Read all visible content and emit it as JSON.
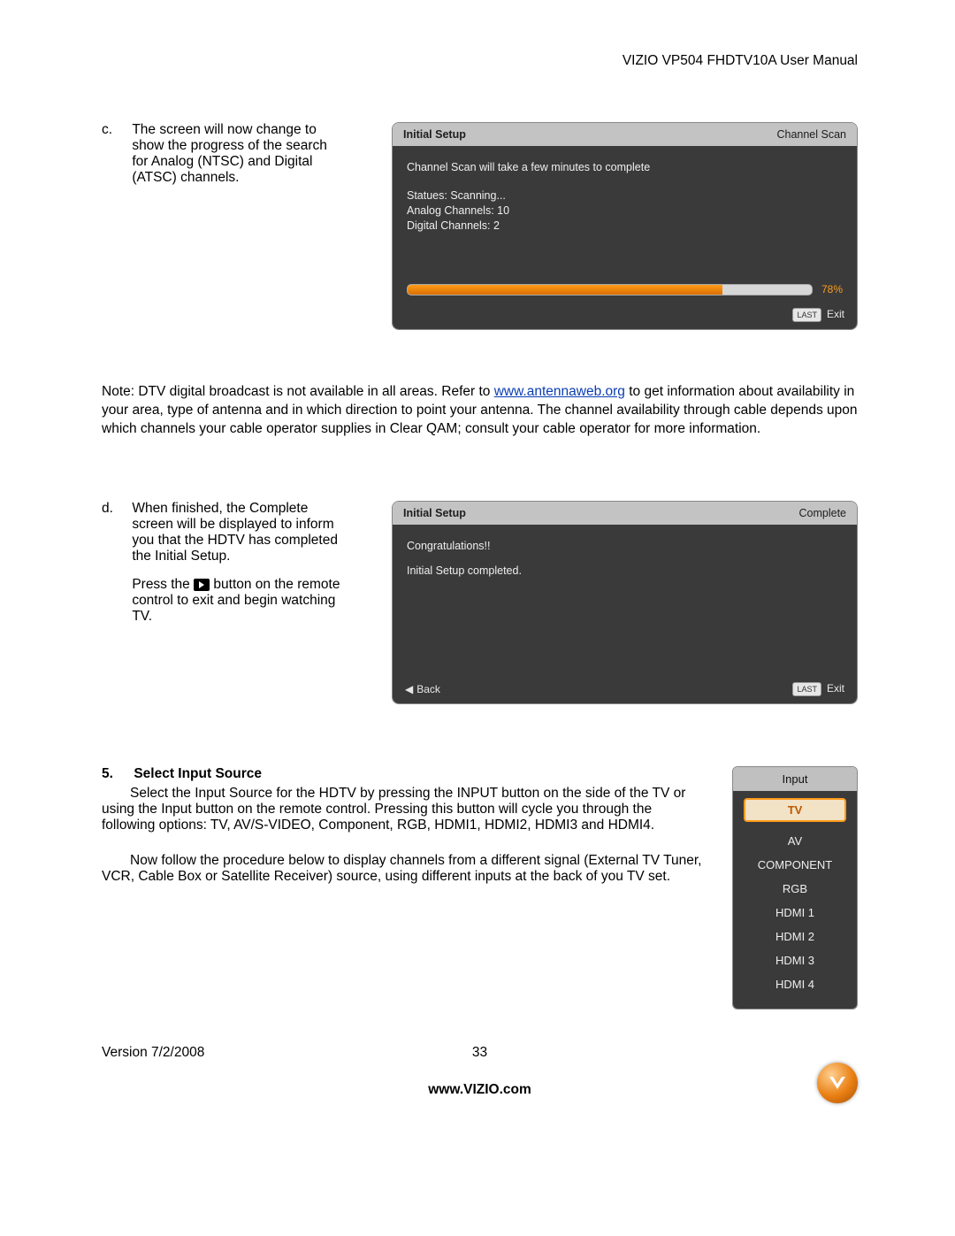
{
  "header": {
    "title": "VIZIO VP504 FHDTV10A User Manual"
  },
  "section_c": {
    "letter": "c.",
    "text": "The screen will now change to show the progress of the search for Analog (NTSC) and Digital (ATSC) channels."
  },
  "osd_scan": {
    "bar_left": "Initial Setup",
    "bar_right": "Channel Scan",
    "line1": "Channel Scan will take a few minutes to complete",
    "status": "Statues: Scanning...",
    "analog": "Analog Channels: 10",
    "digital": "Digital Channels: 2",
    "percent": "78%",
    "percent_width": "78%",
    "foot_last": "LAST",
    "foot_exit": "Exit"
  },
  "note": {
    "pre": "Note: DTV digital broadcast is not available in all areas.  Refer to ",
    "link": "www.antennaweb.org",
    "post": " to get information about availability in your area, type of antenna and in which direction to point your antenna.  The channel availability through cable depends upon which channels your cable operator supplies in Clear QAM; consult your cable operator for more information."
  },
  "section_d": {
    "letter": "d.",
    "text1": "When finished, the Complete screen will be displayed to inform you that the HDTV has completed the Initial Setup.",
    "press_pre": "Press the ",
    "press_post": " button on the remote control to exit and begin watching TV."
  },
  "osd_complete": {
    "bar_left": "Initial Setup",
    "bar_right": "Complete",
    "line1": "Congratulations!!",
    "line2": "Initial Setup completed.",
    "foot_back": "Back",
    "foot_last": "LAST",
    "foot_exit": "Exit"
  },
  "section5": {
    "num": "5.",
    "heading": "Select Input Source",
    "p1": "Select the Input Source for the HDTV by pressing the INPUT button on the side of the TV or using the Input button on the remote control.  Pressing this button will cycle you through the following options: TV, AV/S-VIDEO, Component, RGB, HDMI1, HDMI2, HDMI3 and HDMI4.",
    "p2": "Now follow the procedure below to display channels from a different signal (External TV Tuner, VCR, Cable Box or Satellite Receiver) source, using different inputs at the back of you TV set."
  },
  "input_menu": {
    "title": "Input",
    "selected": "TV",
    "items": [
      "AV",
      "COMPONENT",
      "RGB",
      "HDMI 1",
      "HDMI 2",
      "HDMI 3",
      "HDMI 4"
    ]
  },
  "footer": {
    "version": "Version 7/2/2008",
    "page": "33",
    "site": "www.VIZIO.com"
  }
}
